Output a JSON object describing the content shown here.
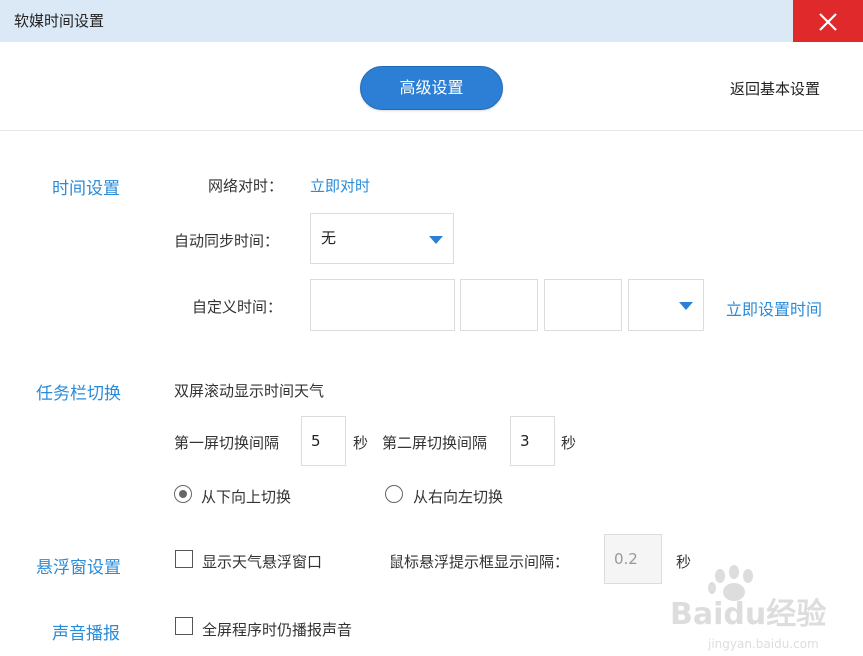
{
  "window": {
    "title": "软媒时间设置"
  },
  "header": {
    "advanced_label": "高级设置",
    "back_label": "返回基本设置"
  },
  "time_settings": {
    "section_title": "时间设置",
    "network_sync_label": "网络对时：",
    "sync_now_link": "立即对时",
    "auto_sync_label": "自动同步时间：",
    "auto_sync_value": "无",
    "custom_time_label": "自定义时间：",
    "set_now_link": "立即设置时间"
  },
  "taskbar": {
    "section_title": "任务栏切换",
    "description": "双屏滚动显示时间天气",
    "first_interval_label": "第一屏切换间隔",
    "first_interval_value": "5",
    "second_interval_label": "第二屏切换间隔",
    "second_interval_value": "3",
    "seconds_unit": "秒",
    "option_bottom_up": "从下向上切换",
    "option_right_left": "从右向左切换",
    "selected_option": "从下向上切换"
  },
  "floating": {
    "section_title": "悬浮窗设置",
    "show_weather_label": "显示天气悬浮窗口",
    "show_weather_checked": false,
    "tooltip_interval_label": "鼠标悬浮提示框显示间隔：",
    "tooltip_interval_value": "0.2",
    "seconds_unit": "秒"
  },
  "sound": {
    "section_title": "声音播报",
    "fullscreen_label": "全屏程序时仍播报声音",
    "fullscreen_checked": false
  },
  "watermark": {
    "text": "Baidu经验",
    "subtext": "jingyan.baidu.com"
  },
  "colors": {
    "accent": "#2a8bd8",
    "button": "#2c7fd4",
    "close": "#e0292b",
    "titlebar": "#dbe9f7"
  }
}
